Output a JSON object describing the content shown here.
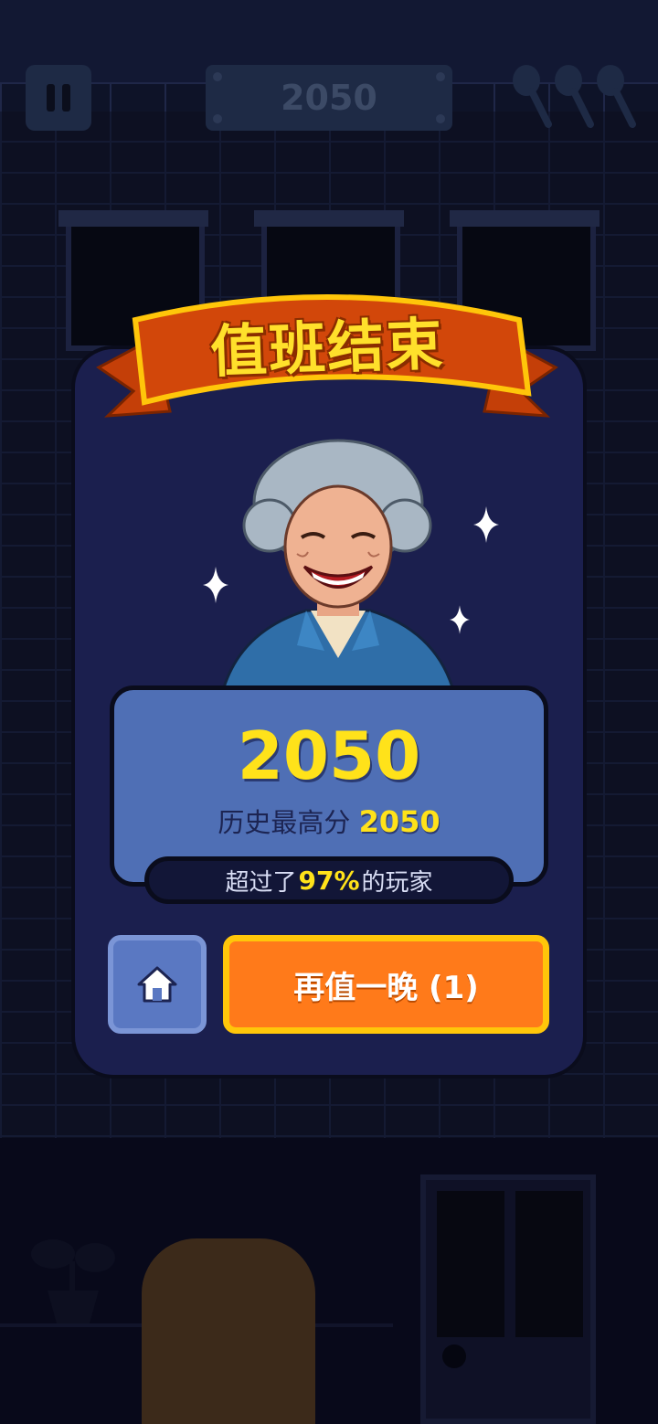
{
  "hud": {
    "score": "2050",
    "lives_icon": "spoon-icon",
    "lives_count": 3
  },
  "modal": {
    "title": "值班结束",
    "score": "2050",
    "best_label": "历史最高分",
    "best_value": "2050",
    "rank_prefix": "超过了",
    "rank_value": "97%",
    "rank_suffix": "的玩家",
    "home_icon": "home-icon",
    "again_label": "再值一晚 (1)"
  },
  "colors": {
    "accent_yellow": "#ffe21a",
    "button_orange": "#ff7a1a",
    "button_border": "#ffc60a",
    "card_bg": "#1b1f4e",
    "score_box_bg": "#4f6fb5",
    "ribbon": "#d2470a"
  }
}
